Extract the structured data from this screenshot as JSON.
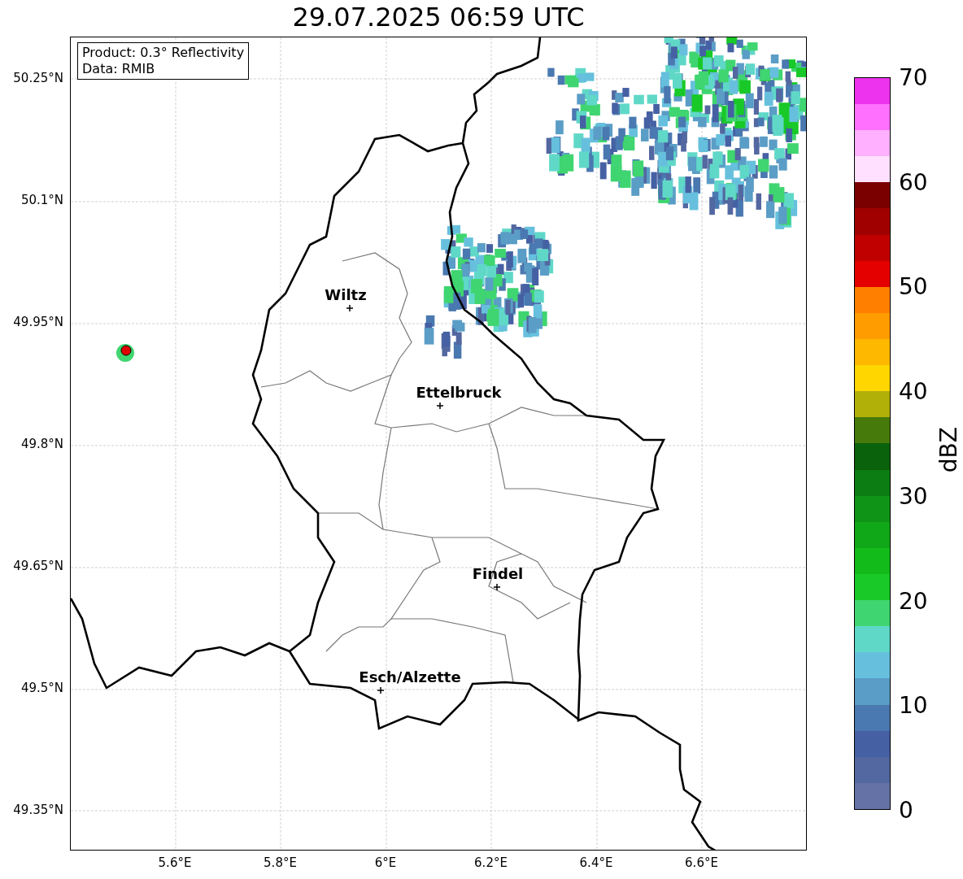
{
  "title": "29.07.2025 06:59 UTC",
  "info_box": [
    "Product: 0.3° Reflectivity",
    "Data: RMIB"
  ],
  "cities": [
    {
      "name": "Wiltz"
    },
    {
      "name": "Ettelbruck"
    },
    {
      "name": "Findel"
    },
    {
      "name": "Esch/Alzette"
    }
  ],
  "x_ticks": [
    "5.6°E",
    "5.8°E",
    "6°E",
    "6.2°E",
    "6.4°E",
    "6.6°E"
  ],
  "y_ticks": [
    "50.25°N",
    "50.1°N",
    "49.95°N",
    "49.8°N",
    "49.65°N",
    "49.5°N",
    "49.35°N"
  ],
  "colorbar": {
    "label": "dBZ",
    "ticks": [
      "70",
      "60",
      "50",
      "40",
      "30",
      "20",
      "10",
      "0"
    ],
    "segments": [
      {
        "color": "#6472a6"
      },
      {
        "color": "#5367a0"
      },
      {
        "color": "#4560a3"
      },
      {
        "color": "#4a78b0"
      },
      {
        "color": "#5a9dc6"
      },
      {
        "color": "#66c0dd"
      },
      {
        "color": "#60d8c8"
      },
      {
        "color": "#3fd570"
      },
      {
        "color": "#18c928"
      },
      {
        "color": "#12bb1a"
      },
      {
        "color": "#10a818"
      },
      {
        "color": "#0f9418"
      },
      {
        "color": "#0c7d12"
      },
      {
        "color": "#0a620c"
      },
      {
        "color": "#467a0a"
      },
      {
        "color": "#b0b008"
      },
      {
        "color": "#ffd600"
      },
      {
        "color": "#ffb800"
      },
      {
        "color": "#ff9c00"
      },
      {
        "color": "#ff7f00"
      },
      {
        "color": "#e50000"
      },
      {
        "color": "#c00000"
      },
      {
        "color": "#a00000"
      },
      {
        "color": "#7a0000"
      },
      {
        "color": "#ffe0ff"
      },
      {
        "color": "#ffb0ff"
      },
      {
        "color": "#ff70ff"
      },
      {
        "color": "#ee33ee"
      }
    ]
  }
}
